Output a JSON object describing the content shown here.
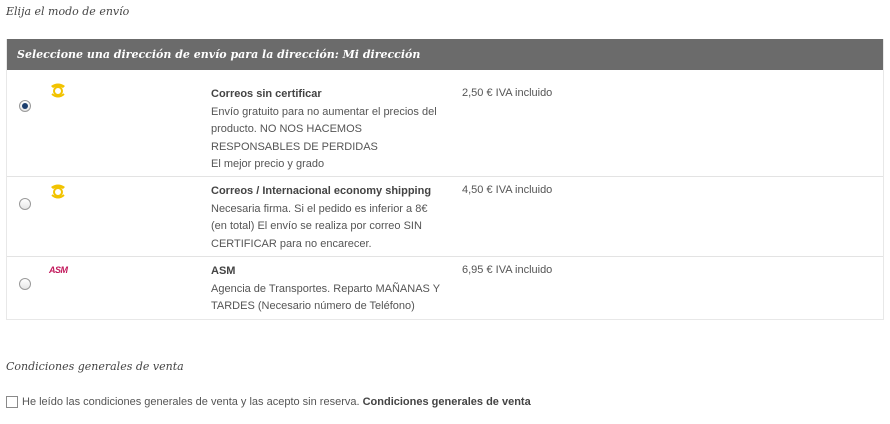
{
  "page_title": "Elija el modo de envío",
  "table": {
    "header": "Seleccione una dirección de envío para la dirección: Mi dirección",
    "carriers": [
      {
        "selected": true,
        "logo": "correos-logo",
        "name": "Correos sin certificar",
        "desc_lines": [
          "Envío gratuito para no aumentar el precios del",
          "producto. NO NOS HACEMOS",
          "RESPONSABLES DE PERDIDAS",
          "El mejor precio y grado"
        ],
        "price": "2,50 € IVA incluido"
      },
      {
        "selected": false,
        "logo": "correos-logo",
        "name": "Correos / Internacional economy shipping",
        "desc_lines": [
          "Necesaria firma. Si el pedido es inferior a 8€",
          "(en total) El envío se realiza por correo SIN",
          "CERTIFICAR para no encarecer."
        ],
        "price": "4,50 € IVA incluido"
      },
      {
        "selected": false,
        "logo": "asm-logo",
        "logo_text": "ASM",
        "name": "ASM",
        "desc_lines": [
          "Agencia de Transportes. Reparto MAÑANAS Y",
          "TARDES (Necesario número de Teléfono)"
        ],
        "price": "6,95 € IVA incluido"
      }
    ]
  },
  "conditions": {
    "title": "Condiciones generales de venta",
    "checkbox_checked": false,
    "checkbox_label": "He leído las condiciones generales de venta y las acepto sin reserva.",
    "link_label": "Condiciones generales de venta"
  },
  "colors": {
    "header_bg": "#6b6b6b",
    "correos_yellow": "#f2c300",
    "asm_red": "#c2185b"
  }
}
